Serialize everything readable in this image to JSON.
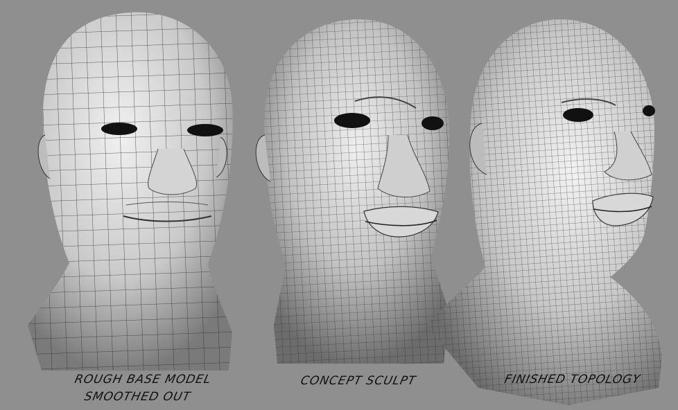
{
  "scene": {
    "background_color": "#8f8f8f",
    "mesh_color": "#2a2a2a",
    "shade_light": "#ececec",
    "shade_dark": "#6f6f6f"
  },
  "panels": [
    {
      "id": "rough",
      "caption_line1": "ROUGH BASE MODEL",
      "caption_line2": "SMOOTHED OUT"
    },
    {
      "id": "concept",
      "caption_line1": "CONCEPT SCULPT"
    },
    {
      "id": "finished",
      "caption_line1": "FINISHED TOPOLOGY"
    }
  ]
}
